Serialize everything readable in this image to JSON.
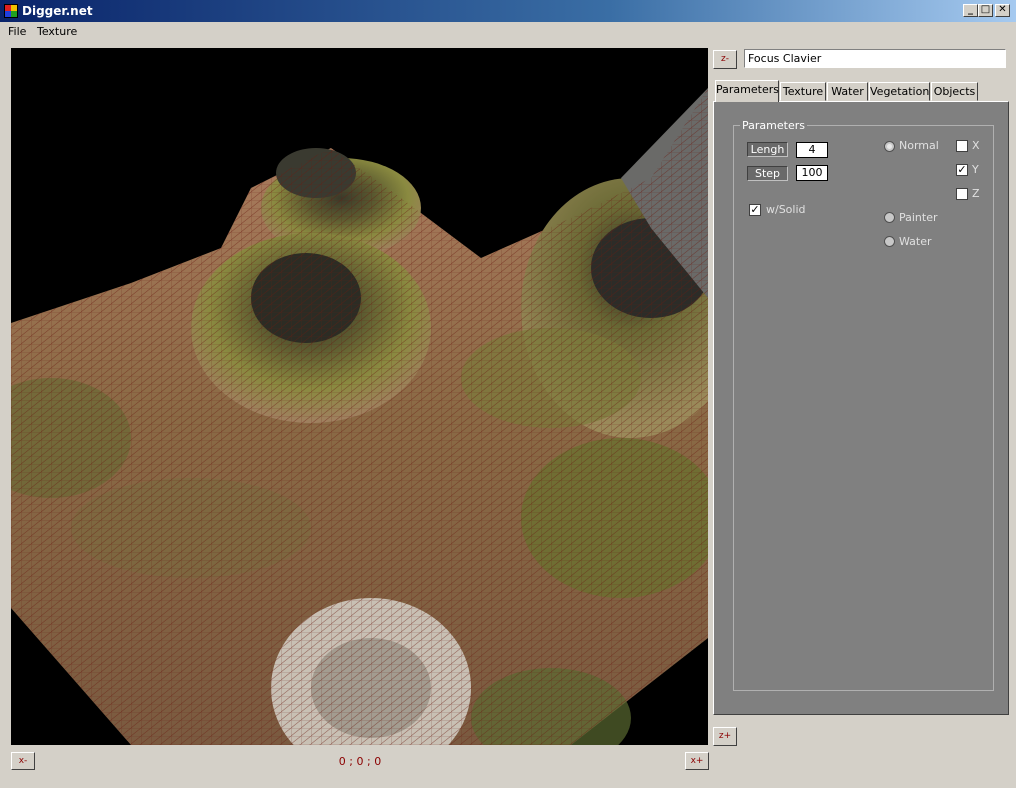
{
  "window": {
    "title": "Digger.net",
    "minimize_icon": "minimize-icon",
    "maximize_icon": "maximize-icon",
    "close_icon": "close-icon"
  },
  "menu": {
    "items": [
      "File",
      "Texture"
    ]
  },
  "viewport": {
    "content": "3D terrain render with textured hills and wireframe mesh"
  },
  "bottom": {
    "x_minus": "x-",
    "x_plus": "x+",
    "coords": "0 ; 0 ; 0"
  },
  "right": {
    "z_minus": "z-",
    "z_plus": "z+",
    "focus_value": "Focus Clavier",
    "tabs": [
      "Parameters",
      "Texture",
      "Water",
      "Vegetation",
      "Objects"
    ],
    "active_tab": "Parameters"
  },
  "parameters": {
    "group_title": "Parameters",
    "length_label": "Lengh",
    "length_value": "4",
    "step_label": "Step",
    "step_value": "100",
    "solid_label": "w/Solid",
    "solid_checked": true,
    "modes": [
      {
        "label": "Normal",
        "selected": true
      },
      {
        "label": "Painter",
        "selected": false
      },
      {
        "label": "Water",
        "selected": false
      }
    ],
    "axes": [
      {
        "label": "X",
        "checked": false
      },
      {
        "label": "Y",
        "checked": true
      },
      {
        "label": "Z",
        "checked": false
      }
    ]
  },
  "colors": {
    "titlebar": "#0a246a",
    "panel": "#808080",
    "accent_text": "#8b0000"
  }
}
